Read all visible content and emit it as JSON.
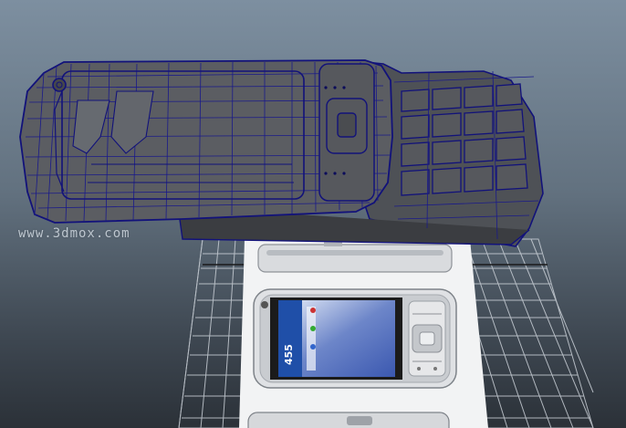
{
  "watermark": {
    "url": "www.3dmox.com"
  },
  "phone_screen": {
    "number": "455"
  },
  "colors": {
    "background_top": "#7d8fa0",
    "background_bottom": "#2b3138",
    "wireframe": "#12127a",
    "model_fill": "#5b5d62",
    "reference_plane": "#f2f3f4"
  }
}
